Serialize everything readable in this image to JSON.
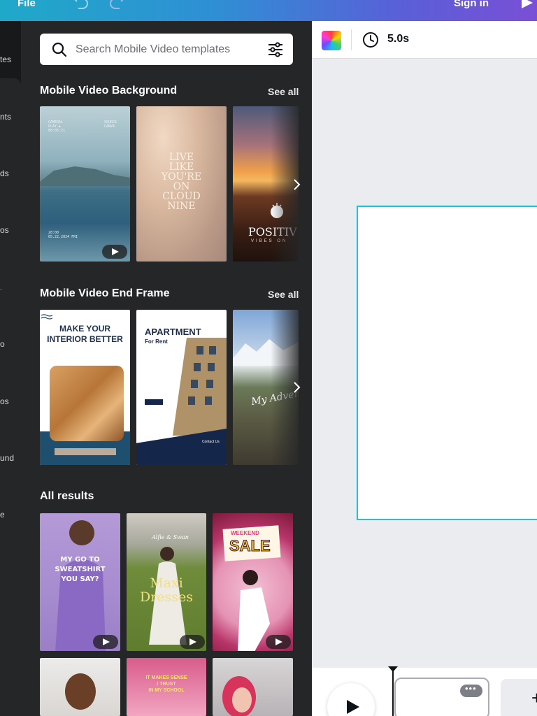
{
  "topbar": {
    "file_label": "File",
    "signin_label": "Sign in"
  },
  "rail": {
    "labels": [
      "tes",
      "nts",
      "ds",
      "os",
      "o",
      "os",
      "und",
      "e"
    ]
  },
  "panel": {
    "search": {
      "placeholder": "Search Mobile Video templates"
    },
    "sections": [
      {
        "title": "Mobile Video Background",
        "see_all": "See all"
      },
      {
        "title": "Mobile Video End Frame",
        "see_all": "See all"
      },
      {
        "title": "All results"
      }
    ],
    "thumbs": {
      "bg1_top": "CAMERAL\nPLAY ▶\n00:05:21",
      "bg1_top_right": "SOURCE\nCANVA",
      "bg1_bottom": "28:00\n05.22.2024 FRI",
      "bg2_text": "LIVE\nLIKE\nYOU'RE\nON\nCLOUD\nNINE",
      "bg3_text": "POSITIV",
      "bg3_sub": "VIBES ON",
      "end1_title": "MAKE YOUR\nINTERIOR BETTER",
      "end2_title": "APARTMENT",
      "end2_sub": "For Rent",
      "end2_footer": "Contact Us",
      "end3_text": "My Adven",
      "res1_text": "MY GO TO\nSWEATSHIRT\nYOU SAY?",
      "res2_text": "Maxi\nDresses",
      "res2_brand": "Alfie & Swan",
      "res3_tag": "WEEKEND",
      "res3_text": "SALE",
      "res5_text": "IT MAKES SENSE\nI TRUST\nIN MY SCHOOL"
    }
  },
  "editor": {
    "duration": "5.0s"
  },
  "colors": {
    "accent": "#1fc3d6",
    "panel": "#252627",
    "topbar_start": "#1fa9c9",
    "topbar_end": "#7a4fd6"
  }
}
